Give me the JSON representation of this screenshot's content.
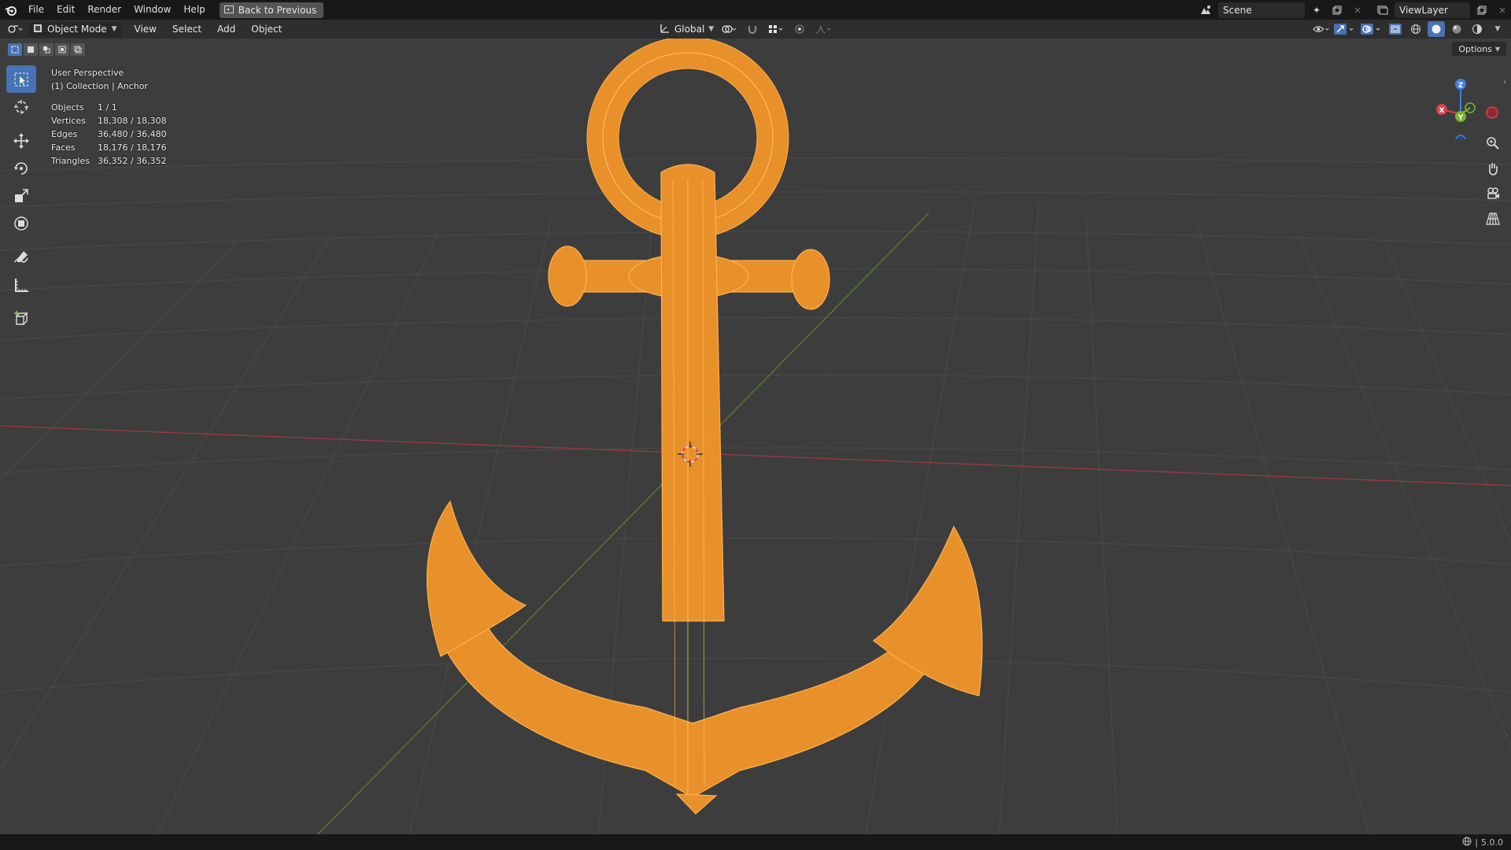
{
  "menu": {
    "items": [
      "File",
      "Edit",
      "Render",
      "Window",
      "Help"
    ],
    "back_button": "Back to Previous"
  },
  "topright": {
    "scene_name": "Scene",
    "view_layer": "ViewLayer"
  },
  "header": {
    "mode": "Object Mode",
    "menus": [
      "View",
      "Select",
      "Add",
      "Object"
    ],
    "transform_orientation": "Global",
    "options_label": "Options"
  },
  "overlay": {
    "view_name": "User Perspective",
    "collection_line": "(1) Collection | Anchor",
    "stats": [
      {
        "label": "Objects",
        "value": "1 / 1"
      },
      {
        "label": "Vertices",
        "value": "18,308 / 18,308"
      },
      {
        "label": "Edges",
        "value": "36,480 / 36,480"
      },
      {
        "label": "Faces",
        "value": "18,176 / 18,176"
      },
      {
        "label": "Triangles",
        "value": "36,352 / 36,352"
      }
    ]
  },
  "gizmo": {
    "x_label": "X",
    "y_label": "Y",
    "z_label": "Z"
  },
  "status": {
    "version": "5.0.0"
  },
  "colors": {
    "accent": "#4772b3",
    "selection": "#f59a2a",
    "x_axis": "#d8424a",
    "y_axis": "#7ab52c",
    "z_axis": "#3f7fe0"
  }
}
